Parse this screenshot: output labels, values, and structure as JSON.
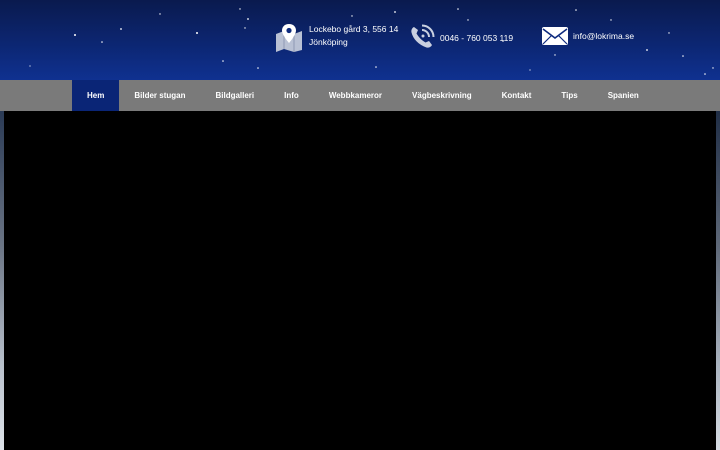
{
  "header": {
    "address_line1": "Lockebo gård 3, 556 14",
    "address_line2": "Jönköping",
    "phone": "0046 - 760 053 119",
    "email": "info@lokrima.se",
    "background_color": "#0c2672",
    "icon_color": "#c9d0e0"
  },
  "nav": {
    "items": [
      {
        "label": "Hem",
        "active": true
      },
      {
        "label": "Bilder stugan"
      },
      {
        "label": "Bildgalleri"
      },
      {
        "label": "Info"
      },
      {
        "label": "Webbkameror"
      },
      {
        "label": "Vägbeskrivning"
      },
      {
        "label": "Kontakt"
      },
      {
        "label": "Tips"
      },
      {
        "label": "Spanien"
      }
    ],
    "background_color": "#7a7a7a",
    "active_color": "#0a2576"
  },
  "icons": {
    "address": "map-pin-icon",
    "phone": "phone-icon",
    "email": "envelope-icon"
  }
}
